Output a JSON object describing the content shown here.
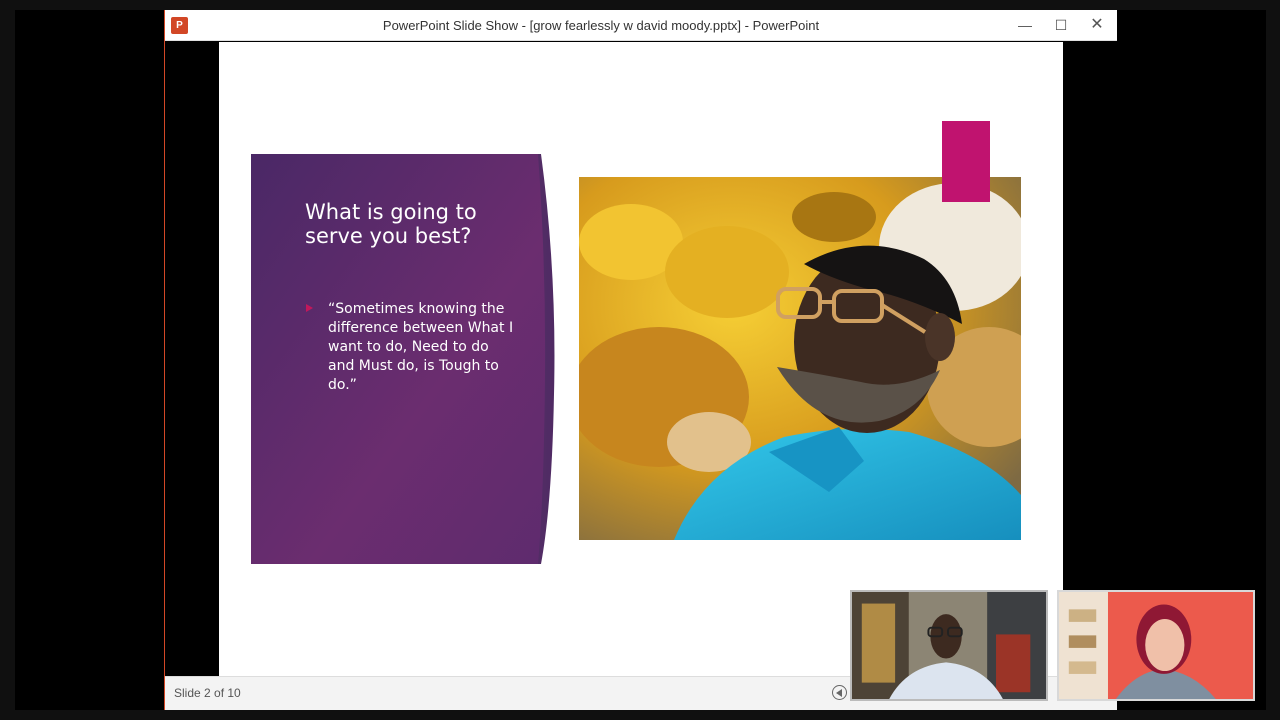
{
  "window": {
    "title": "PowerPoint Slide Show - [grow fearlessly w david moody.pptx] - PowerPoint",
    "app_icon": "powerpoint-icon",
    "minimize_icon": "minimize-icon",
    "maximize_icon": "maximize-icon",
    "close_icon": "close-icon"
  },
  "slide": {
    "title": "What is going to serve you best?",
    "bullet": "“Sometimes knowing the difference between What I want to do, Need to do and Must do, is Tough to do.”",
    "colors": {
      "purple_dark": "#4a2866",
      "purple_mid": "#6b2d6f",
      "accent": "#c0136f",
      "shirt": "#1dbbe0",
      "leaf": "#e0a81b"
    }
  },
  "status": {
    "slide_counter": "Slide 2 of 10",
    "previous_icon": "previous-slide-icon"
  },
  "video": {
    "participant_one_icon": "participant-video-icon",
    "participant_two_icon": "participant-video-icon"
  }
}
